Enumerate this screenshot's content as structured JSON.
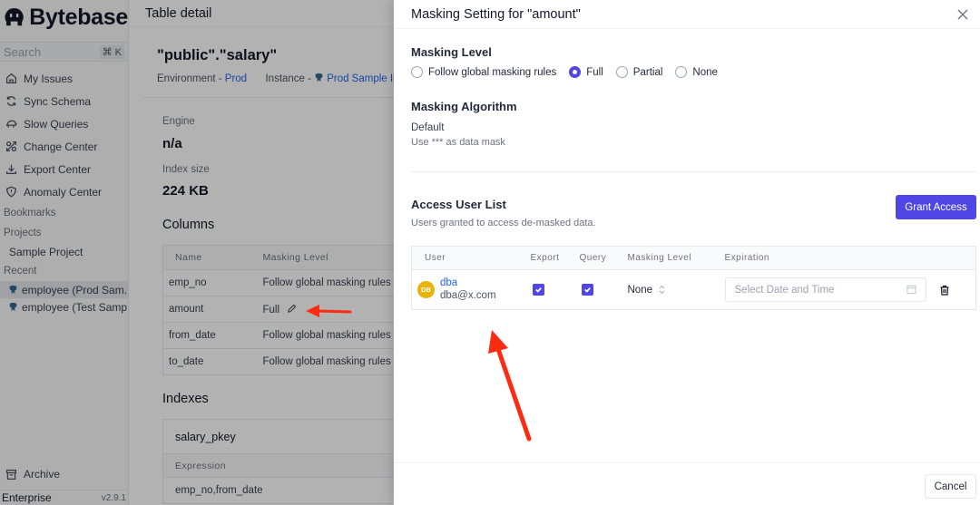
{
  "sidebar": {
    "brand": "Bytebase",
    "search_placeholder": "Search",
    "search_shortcut": "⌘ K",
    "nav": [
      {
        "label": "My Issues",
        "icon": "home-icon"
      },
      {
        "label": "Sync Schema",
        "icon": "sync-icon"
      },
      {
        "label": "Slow Queries",
        "icon": "turtle-icon"
      },
      {
        "label": "Change Center",
        "icon": "change-icon"
      },
      {
        "label": "Export Center",
        "icon": "download-icon"
      },
      {
        "label": "Anomaly Center",
        "icon": "shield-icon"
      }
    ],
    "bookmarks_label": "Bookmarks",
    "projects_label": "Projects",
    "projects": [
      "Sample Project"
    ],
    "recent_label": "Recent",
    "recent": [
      "employee (Prod Sam...",
      "employee (Test Samp..."
    ],
    "archive_label": "Archive",
    "plan": "Enterprise",
    "version": "v2.9.1"
  },
  "main": {
    "header": "Table detail",
    "table_name": "\"public\".\"salary\"",
    "environment_label": "Environment - ",
    "environment": "Prod",
    "instance_label": "Instance - ",
    "instance": "Prod Sample In",
    "engine_label": "Engine",
    "engine_value": "n/a",
    "index_size_label": "Index size",
    "index_size_value": "224 KB",
    "columns_title": "Columns",
    "columns_headers": [
      "Name",
      "Masking Level"
    ],
    "columns_rows": [
      {
        "name": "emp_no",
        "masking": "Follow global masking rules"
      },
      {
        "name": "amount",
        "masking": "Full"
      },
      {
        "name": "from_date",
        "masking": "Follow global masking rules"
      },
      {
        "name": "to_date",
        "masking": "Follow global masking rules"
      }
    ],
    "indexes_title": "Indexes",
    "index_name": "salary_pkey",
    "index_expression_header": "Expression",
    "index_expression": "emp_no,from_date"
  },
  "drawer": {
    "title": "Masking Setting for \"amount\"",
    "masking_level_title": "Masking Level",
    "masking_options": [
      "Follow global masking rules",
      "Full",
      "Partial",
      "None"
    ],
    "masking_selected": "Full",
    "algorithm_title": "Masking Algorithm",
    "algorithm_name": "Default",
    "algorithm_desc": "Use *** as data mask",
    "access_title": "Access User List",
    "access_desc": "Users granted to access de-masked data.",
    "grant_button": "Grant Access",
    "table_headers": [
      "User",
      "Export",
      "Query",
      "Masking Level",
      "Expiration"
    ],
    "users": [
      {
        "initials": "DB",
        "name": "dba",
        "email": "dba@x.com",
        "export": true,
        "query": true,
        "masking_level": "None",
        "expiration_placeholder": "Select Date and Time"
      }
    ],
    "cancel_button": "Cancel"
  },
  "colors": {
    "accent": "#4f46e5",
    "link": "#2563eb",
    "avatar": "#eab308",
    "annotation_arrow": "#ff2a12"
  }
}
